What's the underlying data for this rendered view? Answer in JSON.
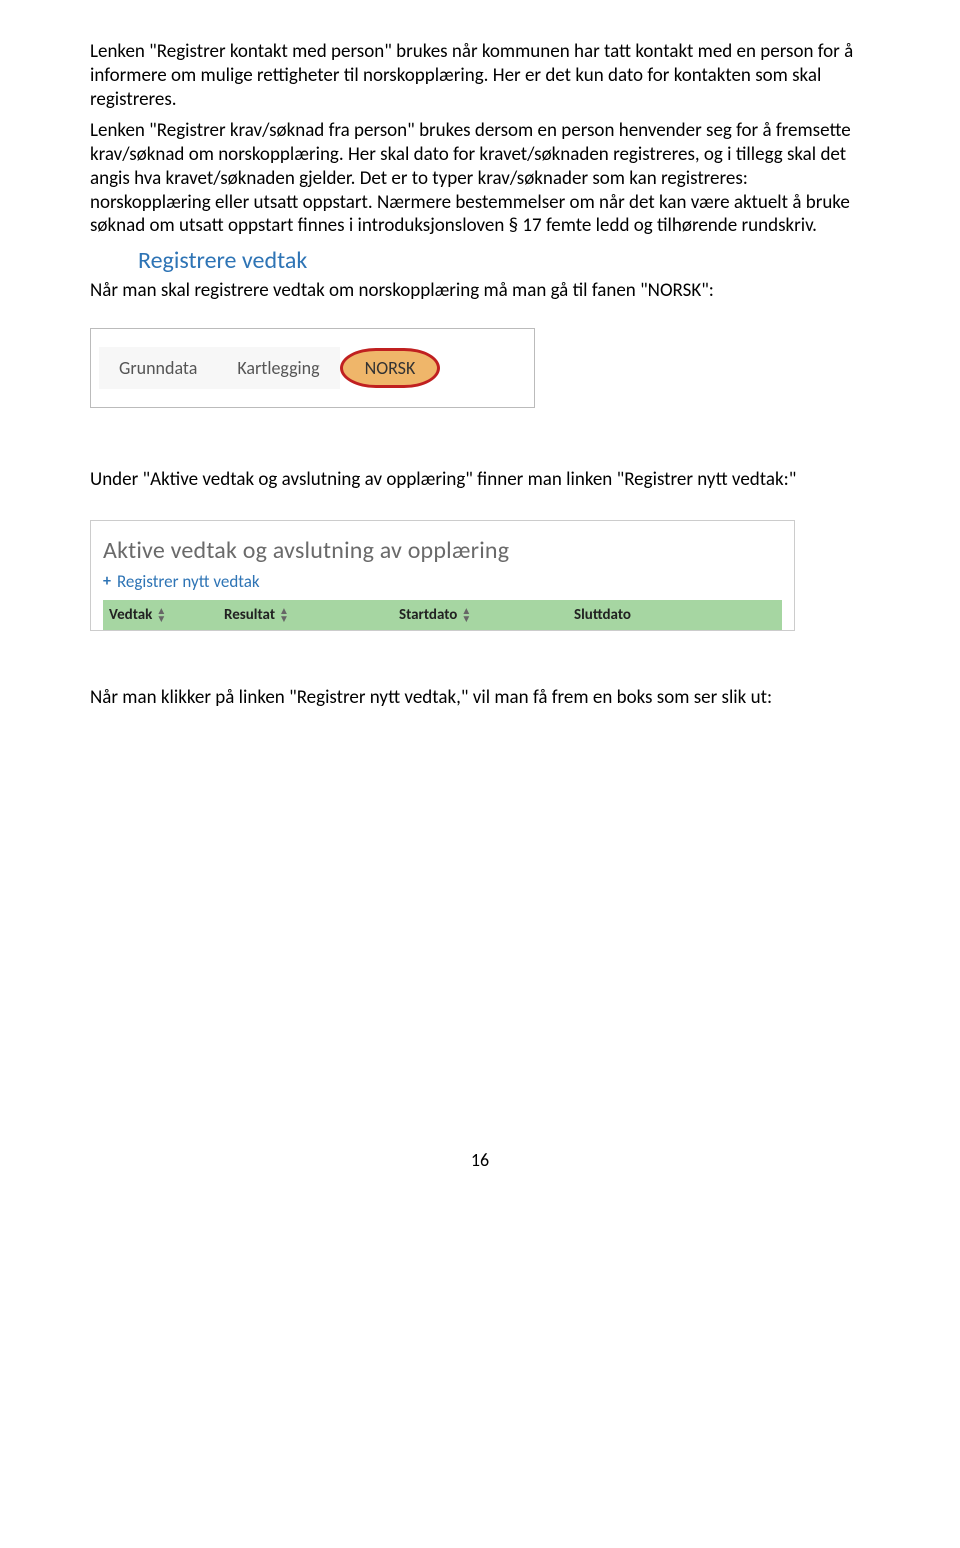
{
  "paragraph1": "Lenken \"Registrer kontakt med person\" brukes når kommunen har tatt kontakt med en person for å informere om mulige rettigheter til norskopplæring. Her er det kun dato for kontakten som skal registreres.",
  "paragraph2": "Lenken \"Registrer krav/søknad fra person\" brukes dersom en person henvender seg for å fremsette krav/søknad om norskopplæring. Her skal dato for kravet/søknaden registreres, og i tillegg skal det angis hva kravet/søknaden gjelder. Det er to typer krav/søknader som kan registreres: norskopplæring eller utsatt oppstart. Nærmere bestemmelser om når det kan være aktuelt å bruke søknad om utsatt oppstart finnes i introduksjonsloven § 17 femte ledd og tilhørende rundskriv.",
  "heading": "Registrere vedtak",
  "paragraph3": "Når man skal registrere vedtak om norskopplæring må man gå til fanen \"NORSK\":",
  "tabs": {
    "t1": "Grunndata",
    "t2": "Kartlegging",
    "t3": "NORSK"
  },
  "paragraph4": "Under \"Aktive vedtak og avslutning av opplæring\" finner man linken \"Registrer nytt vedtak:\"",
  "panel": {
    "title": "Aktive vedtak og avslutning av opplæring",
    "linkText": "Registrer nytt vedtak",
    "columns": [
      "Vedtak",
      "Resultat",
      "Startdato",
      "Sluttdato"
    ]
  },
  "paragraph5": "Når man klikker på linken \"Registrer nytt vedtak,\" vil man få frem en boks som ser slik ut:",
  "pageNumber": "16"
}
